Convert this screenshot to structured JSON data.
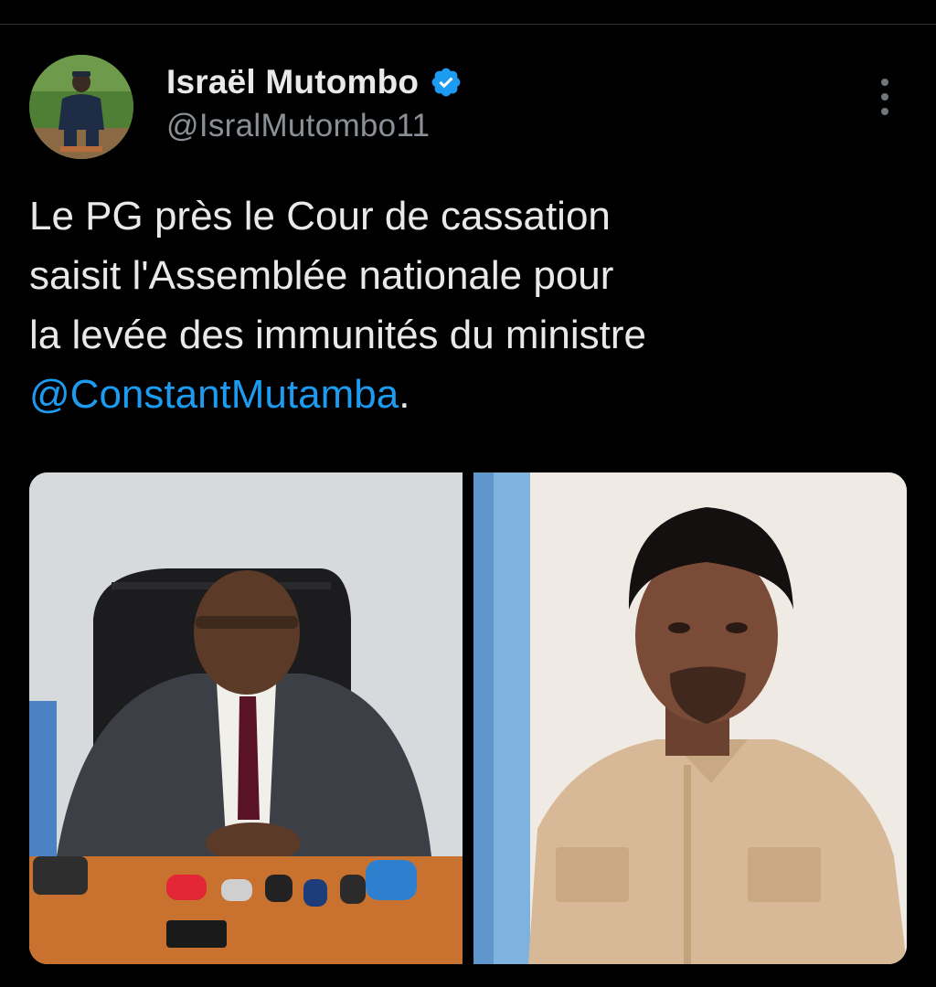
{
  "tweet": {
    "author": {
      "display_name": "Israël Mutombo",
      "handle": "@IsralMutombo11",
      "verified": true,
      "verified_color": "#1d9bf0"
    },
    "text_before": "Le PG  près le Cour de cassation\nsaisit l'Assemblée nationale pour\nla levée des immunités du ministre\n",
    "mention": "@ConstantMutamba",
    "text_after": ".",
    "media": [
      {
        "icon": "photo-prosecutor-press-conference"
      },
      {
        "icon": "photo-minister-portrait"
      }
    ]
  },
  "colors": {
    "background": "#000000",
    "text": "#e7e9ea",
    "secondary": "#8b9096",
    "link": "#1d9bf0"
  }
}
